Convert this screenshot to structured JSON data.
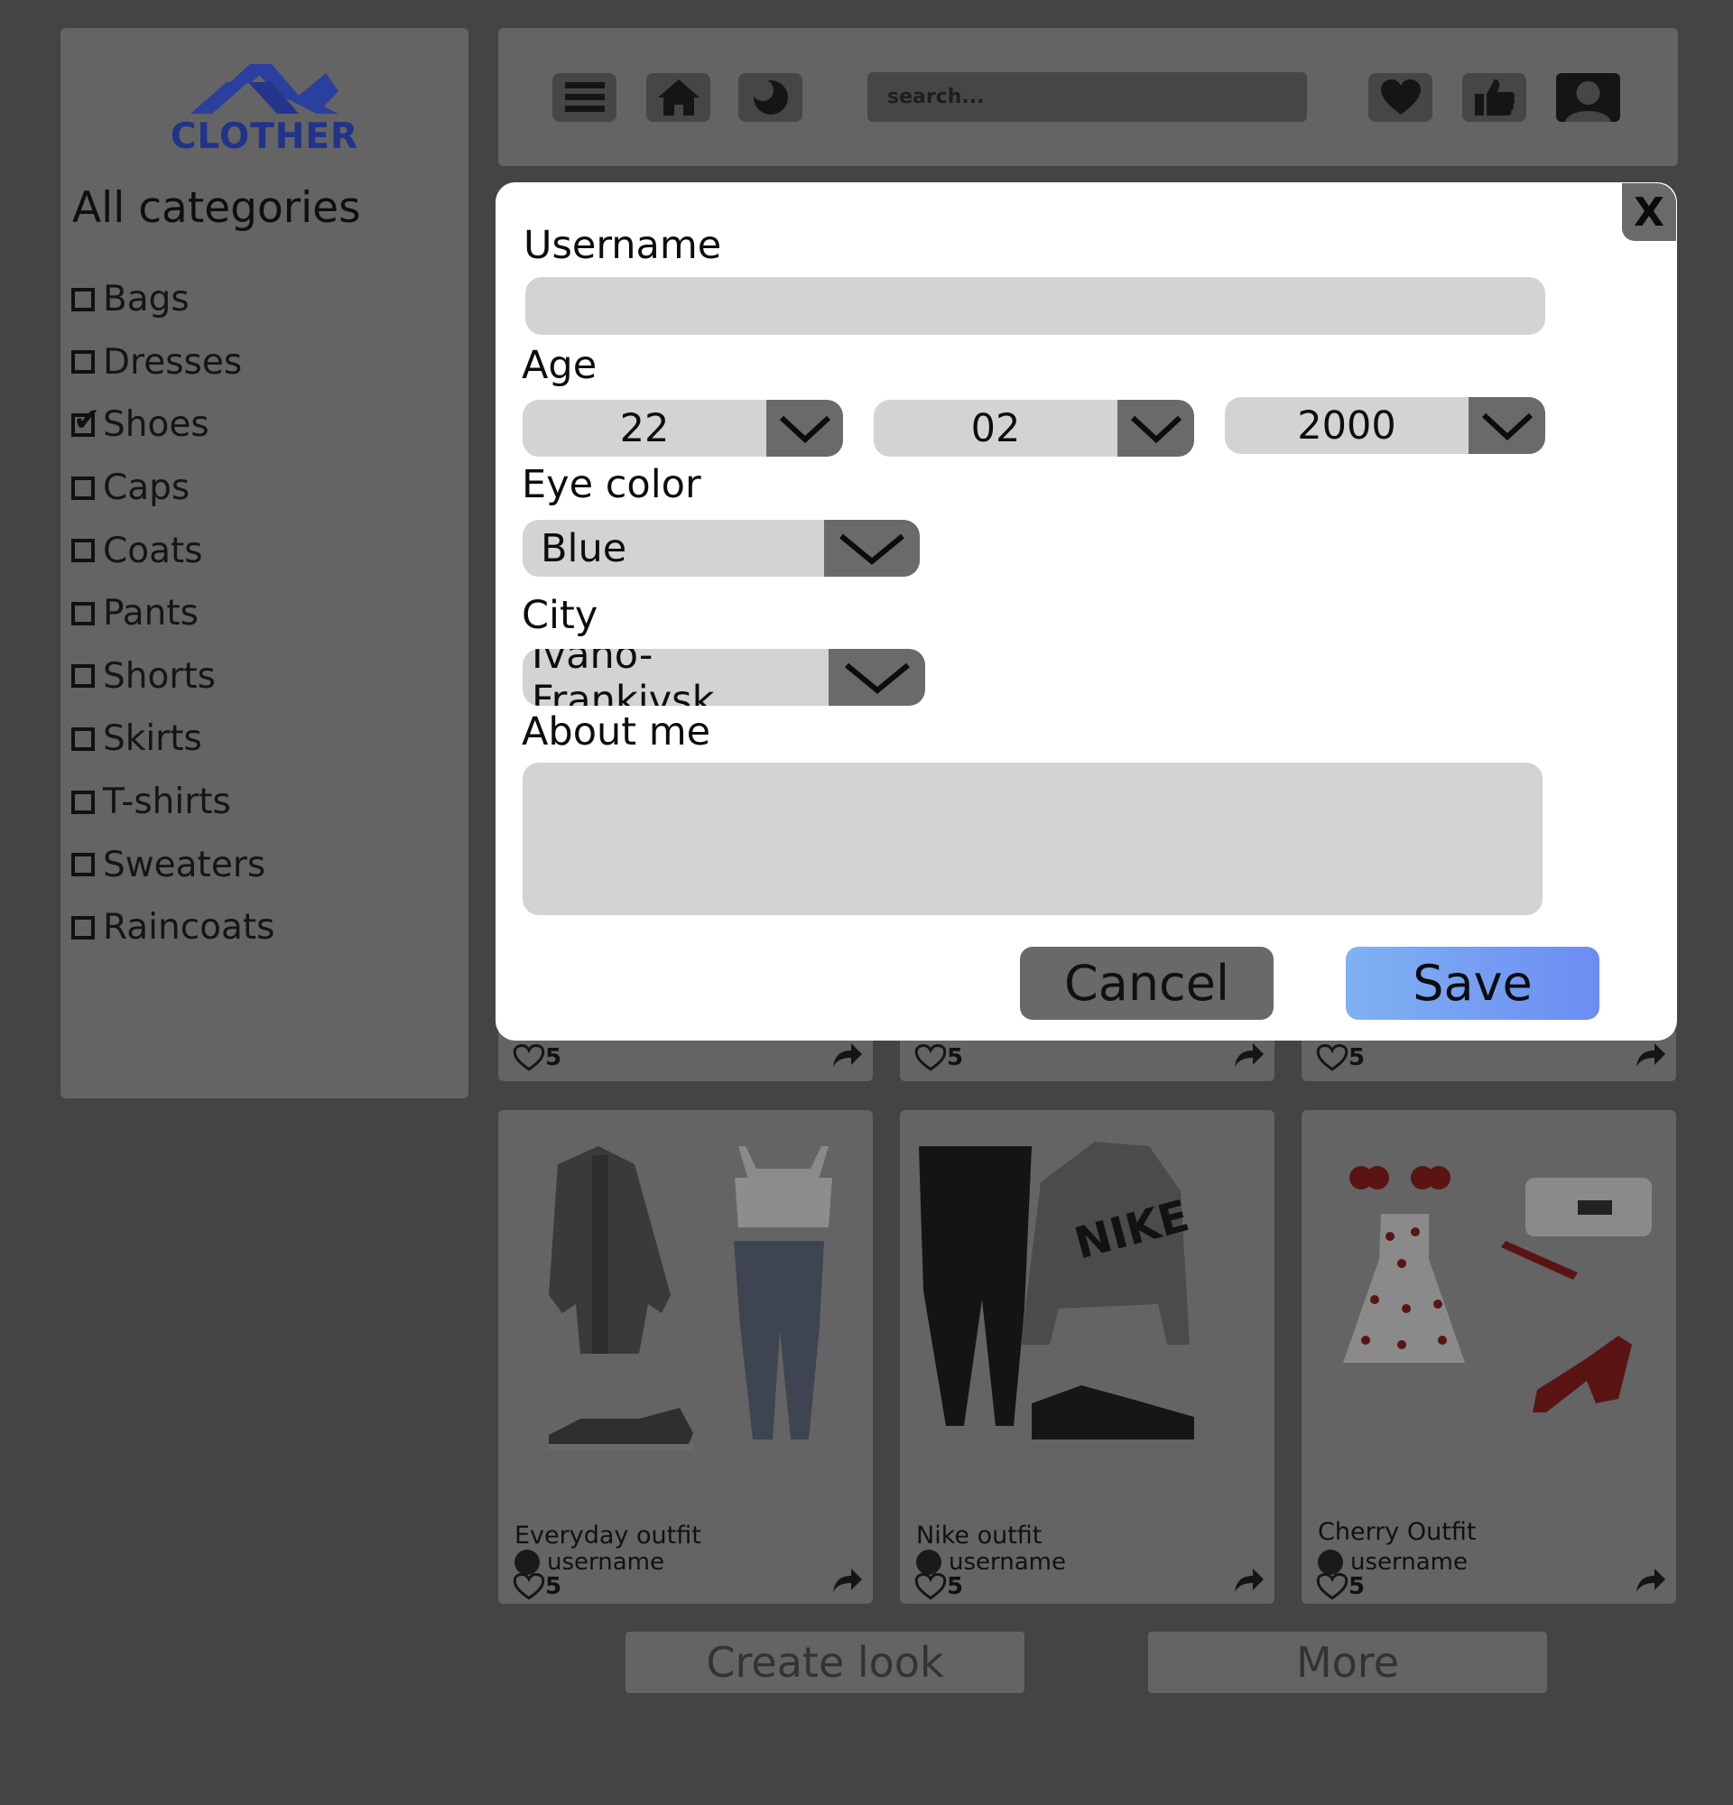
{
  "brand": {
    "name": "CLOTHER",
    "logo_color": "#2a3f9e"
  },
  "sidebar": {
    "title": "All categories",
    "items": [
      {
        "label": "Bags",
        "checked": false
      },
      {
        "label": "Dresses",
        "checked": false
      },
      {
        "label": "Shoes",
        "checked": true
      },
      {
        "label": "Caps",
        "checked": false
      },
      {
        "label": "Coats",
        "checked": false
      },
      {
        "label": "Pants",
        "checked": false
      },
      {
        "label": "Shorts",
        "checked": false
      },
      {
        "label": "Skirts",
        "checked": false
      },
      {
        "label": "T-shirts",
        "checked": false
      },
      {
        "label": "Sweaters",
        "checked": false
      },
      {
        "label": "Raincoats",
        "checked": false
      }
    ]
  },
  "topbar": {
    "icons": [
      "menu-icon",
      "home-icon",
      "theme-icon",
      "heart-icon",
      "thumbs-up-icon",
      "profile-icon"
    ],
    "search_placeholder": "search..."
  },
  "cards_row1": [
    {
      "likes": "5"
    },
    {
      "likes": "5"
    },
    {
      "likes": "5"
    }
  ],
  "cards_row2": [
    {
      "title": "Everyday outfit",
      "user": "username",
      "likes": "5"
    },
    {
      "title": "Nike outfit",
      "user": "username",
      "likes": "5"
    },
    {
      "title": "Cherry Outfit",
      "user": "username",
      "likes": "5"
    }
  ],
  "bottom": {
    "create_label": "Create look",
    "more_label": "More"
  },
  "modal": {
    "close_label": "X",
    "username_label": "Username",
    "username_value": "",
    "age_label": "Age",
    "age_day": "22",
    "age_month": "02",
    "age_year": "2000",
    "eye_label": "Eye color",
    "eye_value": "Blue",
    "city_label": "City",
    "city_value": "Ivano-Frankivsk",
    "about_label": "About me",
    "about_value": "",
    "cancel_label": "Cancel",
    "save_label": "Save",
    "accent": "#6c8cf3"
  }
}
